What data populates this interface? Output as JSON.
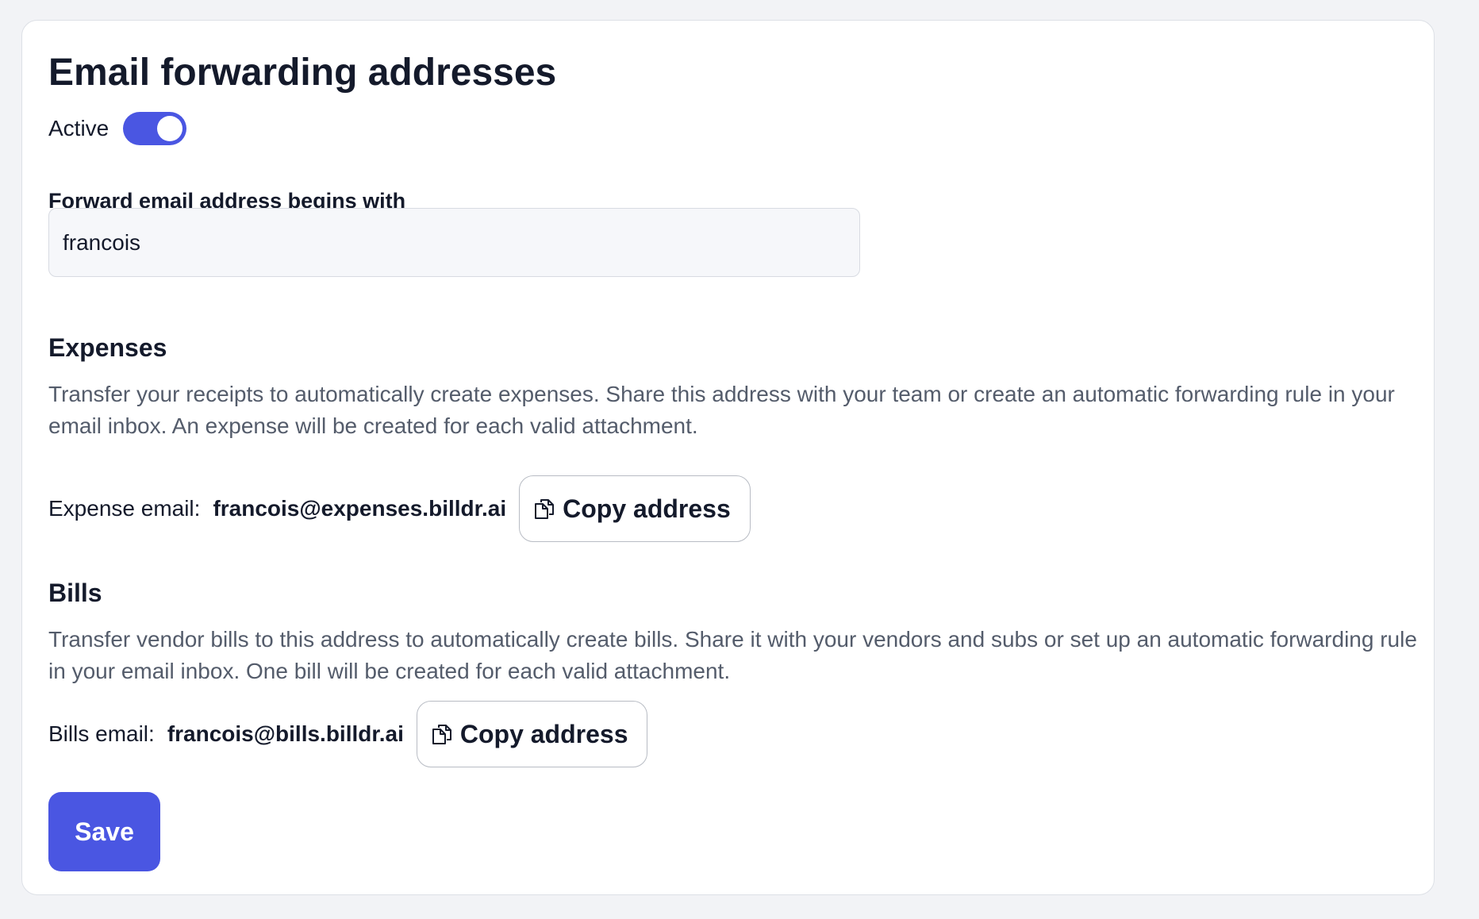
{
  "page": {
    "title": "Email forwarding addresses"
  },
  "active_toggle": {
    "label": "Active",
    "on": true
  },
  "prefix_field": {
    "label": "Forward email address begins with",
    "value": "francois"
  },
  "expenses": {
    "title": "Expenses",
    "description": "Transfer your receipts to automatically create expenses. Share this address with your team or create an automatic forwarding rule in your email inbox. An expense will be created for each valid attachment.",
    "email_label": "Expense email:",
    "email_value": "francois@expenses.billdr.ai",
    "copy_label": "Copy address"
  },
  "bills": {
    "title": "Bills",
    "description": "Transfer vendor bills to this address to automatically create bills. Share it with your vendors and subs or set up an automatic forwarding rule in your email inbox. One bill will be created for each valid attachment.",
    "email_label": "Bills email:",
    "email_value": "francois@bills.billdr.ai",
    "copy_label": "Copy address"
  },
  "actions": {
    "save_label": "Save"
  },
  "icons": {
    "copy": "copy-icon"
  },
  "colors": {
    "accent": "#4a56e2",
    "background": "#f2f3f6",
    "card": "#ffffff",
    "text": "#141a2b",
    "muted_text": "#545c6b"
  }
}
